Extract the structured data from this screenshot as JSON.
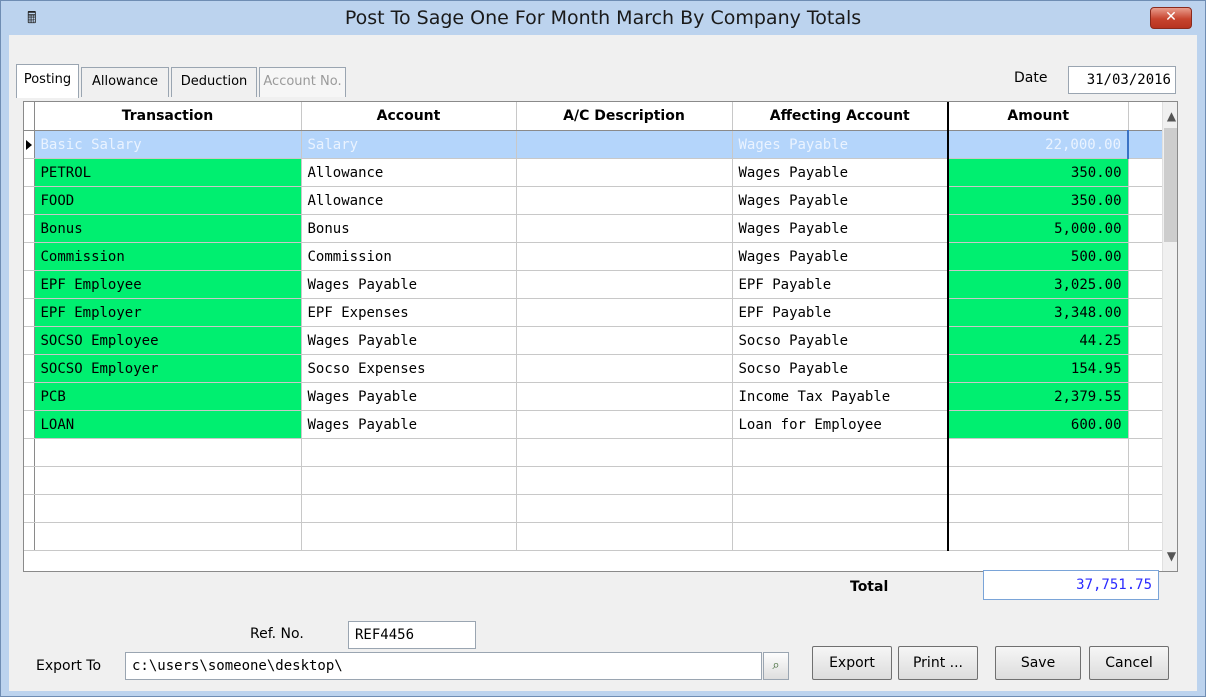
{
  "window": {
    "title": "Post To Sage One For Month March By Company Totals",
    "close_label": "✕"
  },
  "tabs": [
    {
      "label": "Posting",
      "state": "active"
    },
    {
      "label": "Allowance",
      "state": "normal"
    },
    {
      "label": "Deduction",
      "state": "normal"
    },
    {
      "label": "Account No.",
      "state": "disabled"
    }
  ],
  "date": {
    "label": "Date",
    "value": "31/03/2016"
  },
  "grid": {
    "columns": [
      "Transaction",
      "Account",
      "A/C Description",
      "Affecting Account",
      "Amount"
    ],
    "rows": [
      {
        "transaction": "Basic Salary",
        "account": "Salary",
        "description": "",
        "affecting": "Wages Payable",
        "amount": "22,000.00"
      },
      {
        "transaction": "PETROL",
        "account": "Allowance",
        "description": "",
        "affecting": "Wages Payable",
        "amount": "350.00"
      },
      {
        "transaction": "FOOD",
        "account": "Allowance",
        "description": "",
        "affecting": "Wages Payable",
        "amount": "350.00"
      },
      {
        "transaction": "Bonus",
        "account": "Bonus",
        "description": "",
        "affecting": "Wages Payable",
        "amount": "5,000.00"
      },
      {
        "transaction": "Commission",
        "account": "Commission",
        "description": "",
        "affecting": "Wages Payable",
        "amount": "500.00"
      },
      {
        "transaction": "EPF Employee",
        "account": "Wages Payable",
        "description": "",
        "affecting": "EPF Payable",
        "amount": "3,025.00"
      },
      {
        "transaction": "EPF Employer",
        "account": "EPF Expenses",
        "description": "",
        "affecting": "EPF Payable",
        "amount": "3,348.00"
      },
      {
        "transaction": "SOCSO Employee",
        "account": "Wages Payable",
        "description": "",
        "affecting": "Socso Payable",
        "amount": "44.25"
      },
      {
        "transaction": "SOCSO Employer",
        "account": "Socso Expenses",
        "description": "",
        "affecting": "Socso Payable",
        "amount": "154.95"
      },
      {
        "transaction": "PCB",
        "account": "Wages Payable",
        "description": "",
        "affecting": "Income Tax Payable",
        "amount": "2,379.55"
      },
      {
        "transaction": "LOAN",
        "account": "Wages Payable",
        "description": "",
        "affecting": "Loan for Employee",
        "amount": "600.00"
      }
    ],
    "empty_rows": 4,
    "selected_row": 0,
    "highlight_color": "#00ef70",
    "selection_color": "#b4d5fb"
  },
  "total": {
    "label": "Total",
    "value": "37,751.75"
  },
  "ref": {
    "label": "Ref. No.",
    "value": "REF4456"
  },
  "export": {
    "label": "Export To",
    "value": "c:\\users\\someone\\desktop\\"
  },
  "buttons": {
    "export": "Export",
    "print": "Print ...",
    "save": "Save",
    "cancel": "Cancel"
  },
  "icons": {
    "app": "calculator-icon",
    "browse": "search-icon",
    "scroll_up": "chevron-up-icon",
    "scroll_down": "chevron-down-icon"
  }
}
